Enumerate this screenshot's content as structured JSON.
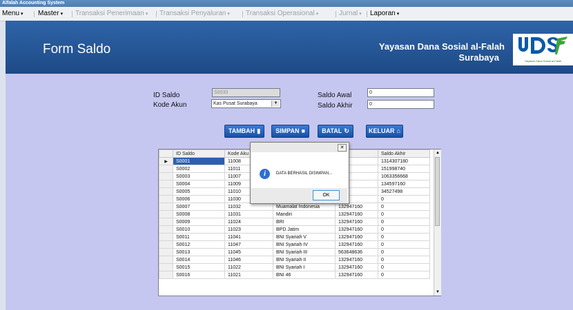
{
  "window_title": "Alfalah Accounting System",
  "menu": [
    {
      "label": "Menu",
      "state": "active"
    },
    {
      "label": "Master",
      "state": "active"
    },
    {
      "label": "Transaksi Penerimaan",
      "state": "dim"
    },
    {
      "label": "Transaksi Penyaluran",
      "state": "dim"
    },
    {
      "label": "Transaksi Operasional",
      "state": "dim"
    },
    {
      "label": "Jurnal",
      "state": "dim"
    },
    {
      "label": "Laporan",
      "state": "active"
    }
  ],
  "dropdown_glyph": "▾",
  "header": {
    "form_title": "Form Saldo",
    "org_line1": "Yayasan Dana Sosial al-Falah",
    "org_line2": "Surabaya",
    "logo_caption": "Yayasan Dana Sosial al-Falah",
    "colors": {
      "blue": "#0b5aa8",
      "green": "#3aa53a"
    }
  },
  "form": {
    "id_saldo_label": "ID Saldo",
    "id_saldo_value": "S0033",
    "kode_akun_label": "Kode Akun",
    "kode_akun_value": "Kas Pusat Surabaya",
    "saldo_awal_label": "Saldo Awal",
    "saldo_awal_value": "0",
    "saldo_akhir_label": "Saldo Akhir",
    "saldo_akhir_value": "0"
  },
  "buttons": {
    "tambah": "TAMBAH",
    "simpan": "SIMPAN",
    "batal": "BATAL",
    "keluar": "KELUAR"
  },
  "table": {
    "headers": [
      "ID Saldo",
      "Kode Akun",
      "",
      "Saldo Awal",
      "Saldo Akhir"
    ],
    "header_visible": [
      "ID Saldo",
      "Kode Aku",
      "",
      "wal",
      "Saldo Akhir"
    ],
    "rows": [
      [
        "S0001",
        "11008",
        "",
        "431",
        "1314307180"
      ],
      [
        "S0002",
        "11011",
        "",
        "61",
        "151998740"
      ],
      [
        "S0003",
        "11007",
        "",
        "64",
        "1063356668"
      ],
      [
        "S0004",
        "11009",
        "",
        "60",
        "134597160"
      ],
      [
        "S0005",
        "11010",
        "",
        "0",
        "34527498"
      ],
      [
        "S0006",
        "11030",
        "",
        "",
        "0"
      ],
      [
        "S0007",
        "11032",
        "Muamalat Indonesia",
        "132947160",
        "0"
      ],
      [
        "S0008",
        "11031",
        "Mandiri",
        "132947160",
        "0"
      ],
      [
        "S0009",
        "11024",
        "BRI",
        "132947160",
        "0"
      ],
      [
        "S0010",
        "11023",
        "BPD Jatim",
        "132947160",
        "0"
      ],
      [
        "S0011",
        "11041",
        "BNI Syariah V",
        "132947160",
        "0"
      ],
      [
        "S0012",
        "11047",
        "BNI Syariah IV",
        "132947160",
        "0"
      ],
      [
        "S0013",
        "11045",
        "BNI Syariah III",
        "563648636",
        "0"
      ],
      [
        "S0014",
        "11046",
        "BNI Syariah II",
        "132947160",
        "0"
      ],
      [
        "S0015",
        "11022",
        "BNI Syariah I",
        "132947160",
        "0"
      ],
      [
        "S0016",
        "11021",
        "BNI 46",
        "132947160",
        "0"
      ]
    ]
  },
  "dialog": {
    "message": "DATA BERHASIL DISIMPAN...",
    "ok_label": "OK",
    "close_glyph": "✕",
    "icon_glyph": "i"
  }
}
